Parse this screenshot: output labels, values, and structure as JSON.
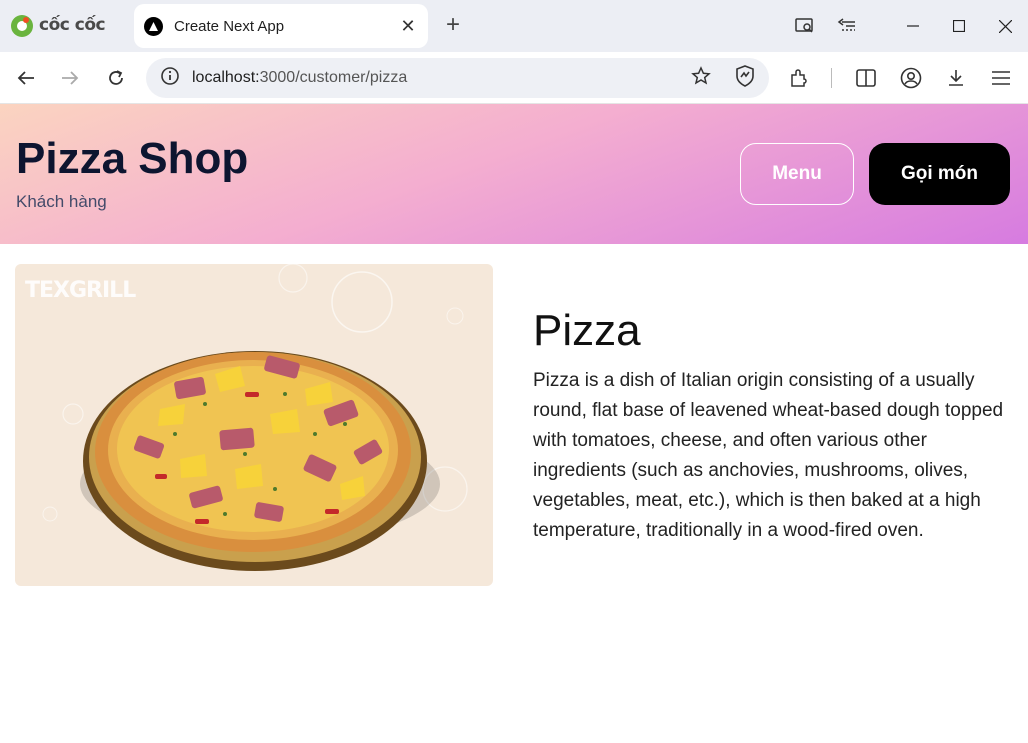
{
  "browser": {
    "brand": "cốc cốc",
    "tab_title": "Create Next App",
    "url_host": "localhost:",
    "url_path": "3000/customer/pizza"
  },
  "header": {
    "title": "Pizza Shop",
    "subtitle": "Khách hàng",
    "menu_label": "Menu",
    "order_label": "Gọi món"
  },
  "product": {
    "name": "Pizza",
    "description": "Pizza is a dish of Italian origin consisting of a usually round, flat base of leavened wheat-based dough topped with tomatoes, cheese, and often various other ingredients (such as anchovies, mushrooms, olives, vegetables, meat, etc.), which is then baked at a high temperature, traditionally in a wood-fired oven.",
    "image_watermark": "TEXGRILL"
  },
  "colors": {
    "header_gradient_start": "#fbd4c0",
    "header_gradient_end": "#d67be0",
    "title_color": "#0d1530",
    "order_button_bg": "#000000",
    "image_card_bg": "#f5e8da"
  }
}
